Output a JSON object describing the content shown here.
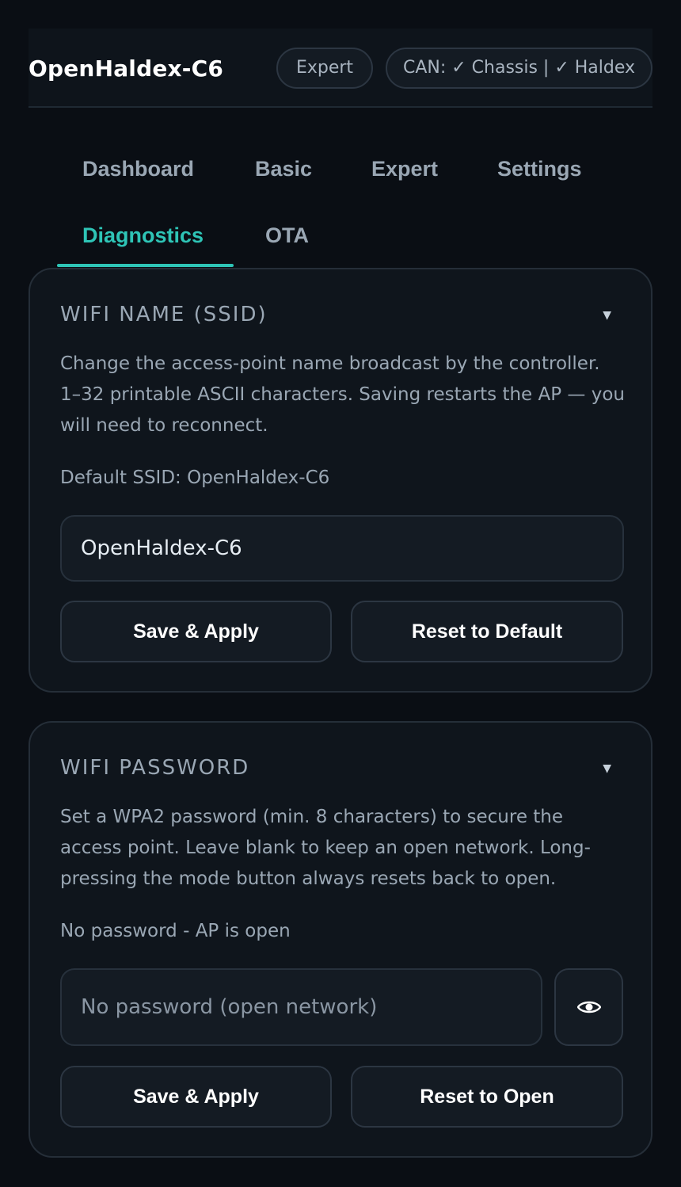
{
  "header": {
    "app_title": "OpenHaldex-C6",
    "mode_badge": "Expert",
    "can_status": "CAN: ✓ Chassis | ✓ Haldex"
  },
  "tabs": [
    {
      "label": "Dashboard",
      "active": false
    },
    {
      "label": "Basic",
      "active": false
    },
    {
      "label": "Expert",
      "active": false
    },
    {
      "label": "Settings",
      "active": false
    },
    {
      "label": "Diagnostics",
      "active": true
    },
    {
      "label": "OTA",
      "active": false
    }
  ],
  "ssid_card": {
    "title": "WIFI NAME (SSID)",
    "description": "Change the access-point name broadcast by the controller. 1–32 printable ASCII characters. Saving restarts the AP — you will need to reconnect.",
    "default_note": "Default SSID: OpenHaldex-C6",
    "input_value": "OpenHaldex-C6",
    "save_label": "Save & Apply",
    "reset_label": "Reset to Default"
  },
  "password_card": {
    "title": "WIFI PASSWORD",
    "description": "Set a WPA2 password (min. 8 characters) to secure the access point. Leave blank to keep an open network. Long-pressing the mode button always resets back to open.",
    "status_note": "No password - AP is open",
    "input_placeholder": "No password (open network)",
    "input_value": "",
    "toggle_icon": "eye-icon",
    "save_label": "Save & Apply",
    "reset_label": "Reset to Open"
  },
  "colors": {
    "background": "#0a0e14",
    "accent": "#2ec4b6",
    "card_border": "#252e38"
  }
}
